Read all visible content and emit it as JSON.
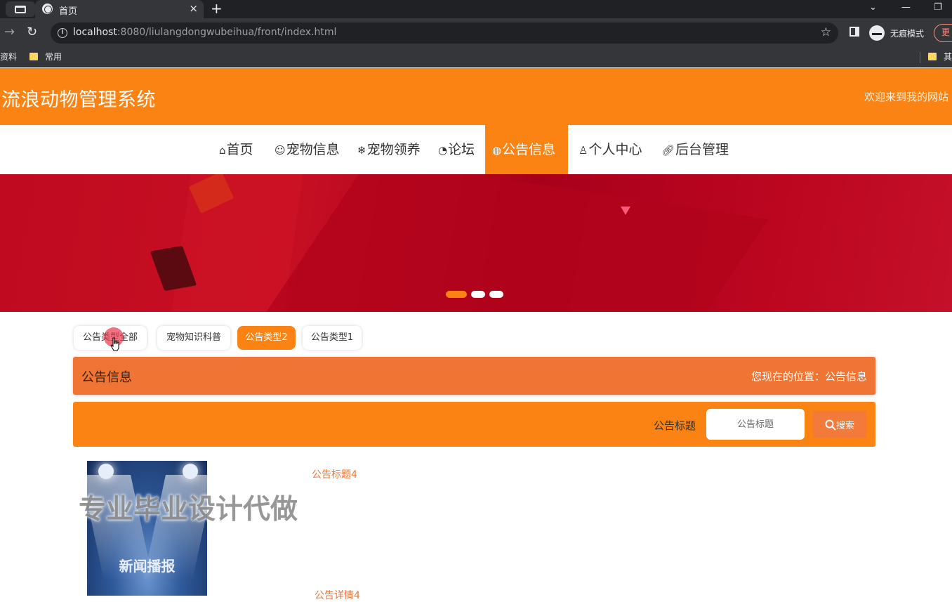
{
  "browser": {
    "tab_title": "首页",
    "tab_close": "×",
    "new_tab": "+",
    "url_host": "localhost",
    "url_rest": ":8080/liulangdongwubeihua/front/index.html",
    "incognito_label": "无痕模式",
    "update_label": "更",
    "bookmarks": [
      "资料",
      "常用",
      "其"
    ]
  },
  "site": {
    "title": "流浪动物管理系统",
    "welcome": "欢迎来到我的网站"
  },
  "nav": {
    "items": [
      {
        "label": "首页",
        "icon": "home-icon"
      },
      {
        "label": "宠物信息",
        "icon": "pet-face-icon"
      },
      {
        "label": "宠物领养",
        "icon": "snowflake-icon"
      },
      {
        "label": "论坛",
        "icon": "gauge-icon"
      },
      {
        "label": "公告信息",
        "icon": "globe-icon",
        "active": true
      },
      {
        "label": "个人中心",
        "icon": "user-icon"
      },
      {
        "label": "后台管理",
        "icon": "link-icon"
      }
    ]
  },
  "banner": {
    "slide_count": 3,
    "active_slide": 1
  },
  "categories": [
    {
      "label": "公告类型全部",
      "active": false
    },
    {
      "label": "宠物知识科普",
      "active": false
    },
    {
      "label": "公告类型2",
      "active": true
    },
    {
      "label": "公告类型1",
      "active": false
    }
  ],
  "breadcrumb": {
    "title": "公告信息",
    "location": "您现在的位置：公告信息"
  },
  "search": {
    "label": "公告标题",
    "placeholder": "公告标题",
    "button": "搜索"
  },
  "news": [
    {
      "title": "公告标题4",
      "detail": "公告详情4",
      "thumb_text": "新闻播报"
    }
  ],
  "watermark": "专业毕业设计代做",
  "colors": {
    "accent": "#fa8313",
    "breadcrumb": "#f07534",
    "browser_dark": "#202124"
  }
}
